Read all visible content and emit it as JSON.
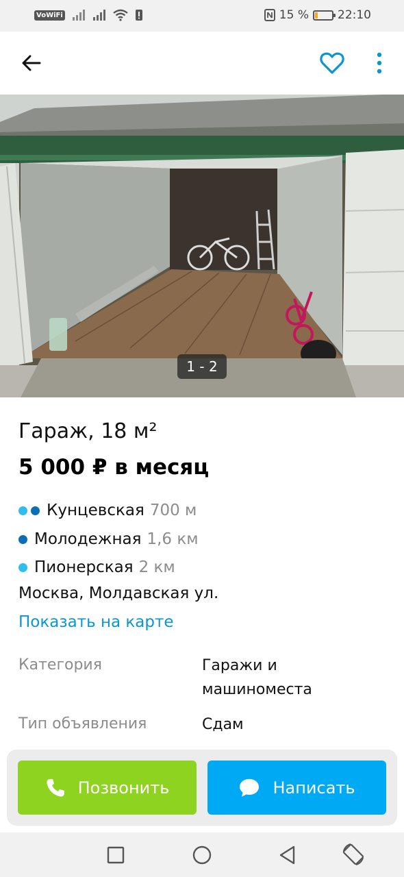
{
  "status_bar": {
    "vowifi": "VoWiFi",
    "battery_percent": "15 %",
    "battery_level": 0.15,
    "time": "22:10"
  },
  "header": {
    "back_icon": "arrow-left-icon",
    "favorite_icon": "heart-outline-icon",
    "more_icon": "more-vertical-icon",
    "accent_color": "#0a95d8"
  },
  "gallery": {
    "counter": "1 - 2"
  },
  "listing": {
    "title": "Гараж, 18 м²",
    "price": "5 000 ₽ в месяц",
    "metro": [
      {
        "name": "Кунцевская",
        "distance": "700 м",
        "colors": [
          "#2fbdf0",
          "#0b6fb8"
        ]
      },
      {
        "name": "Молодежная",
        "distance": "1,6 км",
        "colors": [
          "#0b6fb8"
        ]
      },
      {
        "name": "Пионерская",
        "distance": "2 км",
        "colors": [
          "#2fbdf0"
        ]
      }
    ],
    "address": "Москва, Молдавская ул.",
    "map_link": "Показать на карте"
  },
  "params": [
    {
      "key": "Категория",
      "value": "Гаражи и машиноместа"
    },
    {
      "key": "Тип объявления",
      "value": "Сдам"
    }
  ],
  "actions": {
    "call_label": "Позвонить",
    "message_label": "Написать",
    "call_color": "#8ed31f",
    "message_color": "#00a9f4"
  },
  "nav": {
    "recents_icon": "square-icon",
    "home_icon": "circle-icon",
    "back_icon": "triangle-back-icon",
    "rotate_icon": "rotate-icon"
  }
}
